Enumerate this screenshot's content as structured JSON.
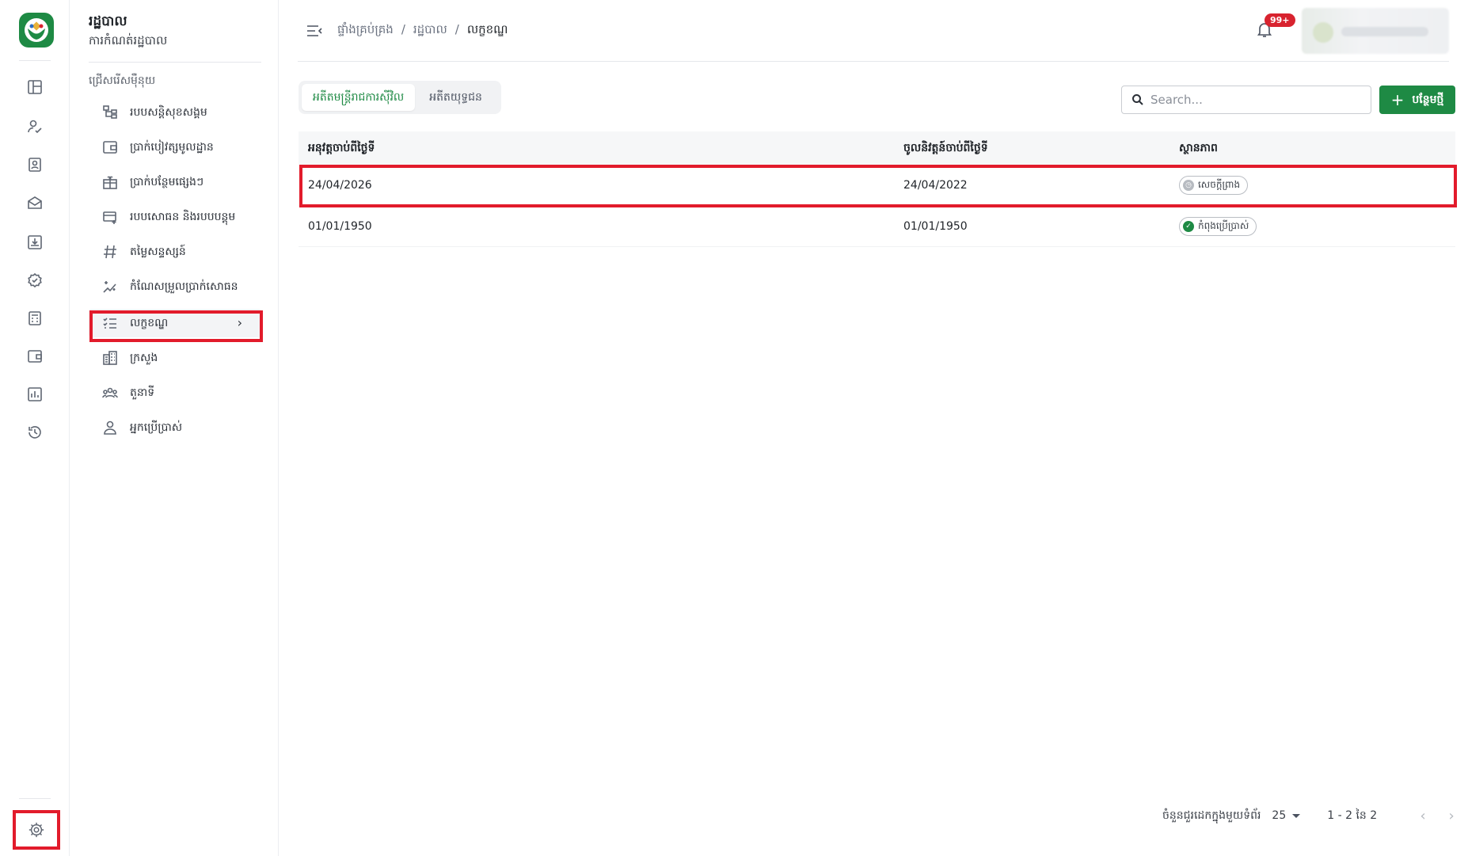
{
  "app": {
    "title": "រដ្ឋបាល",
    "subtitle": "ការកំណត់រដ្ឋបាល"
  },
  "rail_icons": [
    "dashboard-icon",
    "user-check-icon",
    "id-card-icon",
    "mail-open-icon",
    "download-box-icon",
    "badge-check-icon",
    "calculator-icon",
    "wallet-icon",
    "bar-chart-icon",
    "history-icon",
    "settings-icon"
  ],
  "sidebar": {
    "section_label": "ជ្រើសរើសម៉ឺនុយ",
    "items": [
      {
        "label": "របបសន្តិសុខសង្គម",
        "icon": "hierarchy-icon"
      },
      {
        "label": "ប្រាក់បៀវត្សមូលដ្ឋាន",
        "icon": "wallet-icon"
      },
      {
        "label": "ប្រាក់បន្ថែមផ្សេងៗ",
        "icon": "gift-icon"
      },
      {
        "label": "របបសោធន និងរបបបន្តុម",
        "icon": "card-plus-icon"
      },
      {
        "label": "តម្លៃសន្ទស្សន៍",
        "icon": "hash-icon"
      },
      {
        "label": "កំណែសម្រួលប្រាក់សោធន",
        "icon": "sparkle-chart-icon"
      },
      {
        "label": "លក្ខខណ្ឌ",
        "icon": "checklist-icon",
        "active": true
      },
      {
        "label": "ក្រសួង",
        "icon": "building-icon"
      },
      {
        "label": "តួនាទី",
        "icon": "group-icon"
      },
      {
        "label": "អ្នកប្រើប្រាស់",
        "icon": "user-icon"
      }
    ]
  },
  "breadcrumb": {
    "items": [
      "ផ្ទាំងគ្រប់គ្រង",
      "រដ្ឋបាល",
      "លក្ខខណ្ឌ"
    ],
    "separator": "/"
  },
  "notifications": {
    "badge": "99+"
  },
  "tabs": [
    {
      "label": "អតីតមន្ត្រីរាជការស៊ីវិល",
      "active": true
    },
    {
      "label": "អតីតយុទ្ធជន",
      "active": false
    }
  ],
  "search": {
    "placeholder": "Search..."
  },
  "add_button": {
    "label": "បន្ថែមថ្មី"
  },
  "table": {
    "columns": [
      "អនុវត្តចាប់ពីថ្ងៃទី",
      "ចូលនិវត្តន៍ចាប់ពីថ្ងៃទី",
      "ស្ថានភាព"
    ],
    "rows": [
      {
        "effective": "24/04/2026",
        "retire": "24/04/2022",
        "status": "សេចក្តីព្រាង",
        "status_type": "draft"
      },
      {
        "effective": "01/01/1950",
        "retire": "01/01/1950",
        "status": "កំពុងប្រើប្រាស់",
        "status_type": "active"
      }
    ]
  },
  "pagination": {
    "rows_per_page_label": "ចំនួនជួរដេកក្នុងមួយទំព័រ",
    "rows_per_page": "25",
    "range": "1 - 2 នៃ 2"
  },
  "colors": {
    "brand": "#1e8a44",
    "highlight": "#e21b2b",
    "badge": "#d8232f"
  }
}
